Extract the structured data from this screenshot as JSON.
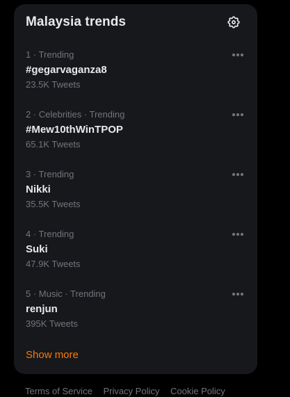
{
  "panel": {
    "title": "Malaysia trends",
    "settings_icon": "gear-icon",
    "more_icon": "ellipsis-icon",
    "accent_color": "#ff7a00",
    "show_more_label": "Show more"
  },
  "trends": [
    {
      "meta": "1 · Trending",
      "name": "#gegarvaganza8",
      "count": "23.5K Tweets"
    },
    {
      "meta": "2 · Celebrities · Trending",
      "name": "#Mew10thWinTPOP",
      "count": "65.1K Tweets"
    },
    {
      "meta": "3 · Trending",
      "name": "Nikki",
      "count": "35.5K Tweets"
    },
    {
      "meta": "4 · Trending",
      "name": "Suki",
      "count": "47.9K Tweets"
    },
    {
      "meta": "5 · Music · Trending",
      "name": "renjun",
      "count": "395K Tweets"
    }
  ],
  "footer": {
    "links": [
      "Terms of Service",
      "Privacy Policy",
      "Cookie Policy"
    ]
  }
}
